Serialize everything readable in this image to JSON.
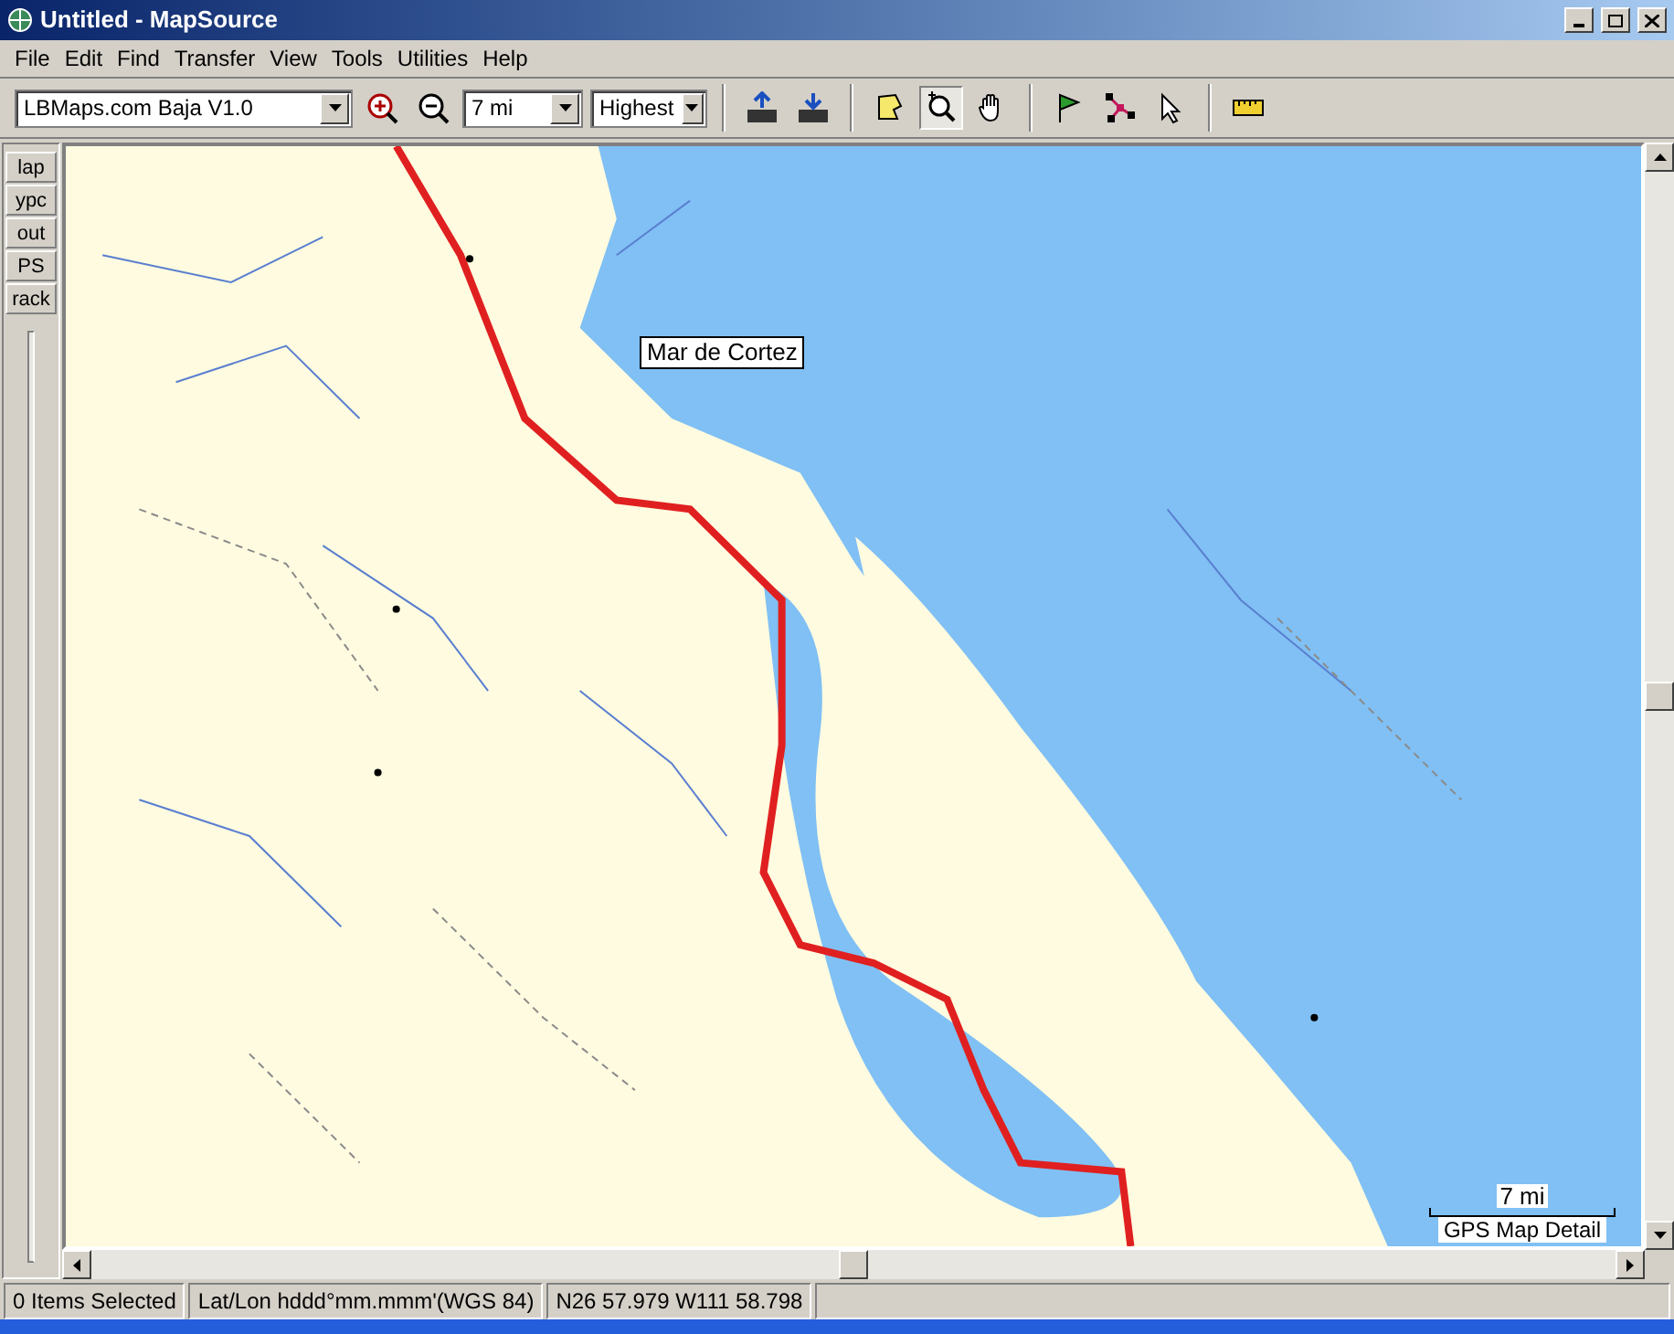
{
  "window": {
    "title": "Untitled - MapSource"
  },
  "menu": [
    "File",
    "Edit",
    "Find",
    "Transfer",
    "View",
    "Tools",
    "Utilities",
    "Help"
  ],
  "toolbar": {
    "product": "LBMaps.com Baja V1.0",
    "zoom_scale": "7 mi",
    "detail": "Highest",
    "tools": [
      {
        "kind": "map",
        "selected": false
      },
      {
        "kind": "zoom",
        "selected": true
      },
      {
        "kind": "hand",
        "selected": false
      },
      {
        "kind": "flag",
        "selected": false
      },
      {
        "kind": "route",
        "selected": false
      },
      {
        "kind": "pointer",
        "selected": false
      },
      {
        "kind": "ruler",
        "selected": false
      }
    ]
  },
  "side_tabs": [
    {
      "label": "lap",
      "selected": false
    },
    {
      "label": "ypc",
      "selected": false
    },
    {
      "label": "out",
      "selected": false
    },
    {
      "label": "PS",
      "selected": false
    },
    {
      "label": "rack",
      "selected": false
    }
  ],
  "map": {
    "kind": "picture",
    "tooltip": "Mar de Cortez",
    "scale": "7 mi",
    "detail_label": "GPS Map Detail"
  },
  "status_bar": [
    "0 Items Selected",
    "Lat/Lon hddd°mm.mmm'(WGS 84)",
    "N26 57.979 W111 58.798"
  ]
}
